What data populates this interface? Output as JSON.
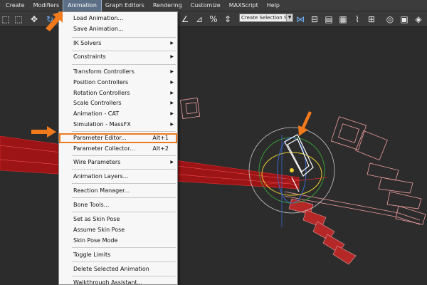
{
  "menubar": {
    "items": [
      "Create",
      "Modifiers",
      "Animation",
      "Graph Editors",
      "Rendering",
      "Customize",
      "MAXScript",
      "Help"
    ],
    "active_index": 2
  },
  "toolbar": {
    "selection_set": "Create Selection Se"
  },
  "animation_menu": {
    "items": [
      {
        "label": "Load Animation...",
        "shortcut": "",
        "submenu": false
      },
      {
        "label": "Save Animation...",
        "shortcut": "",
        "submenu": false
      },
      {
        "label": "IK Solvers",
        "shortcut": "",
        "submenu": true
      },
      {
        "label": "Constraints",
        "shortcut": "",
        "submenu": true
      },
      {
        "label": "Transform Controllers",
        "shortcut": "",
        "submenu": true
      },
      {
        "label": "Position Controllers",
        "shortcut": "",
        "submenu": true
      },
      {
        "label": "Rotation Controllers",
        "shortcut": "",
        "submenu": true
      },
      {
        "label": "Scale Controllers",
        "shortcut": "",
        "submenu": true
      },
      {
        "label": "Animation - CAT",
        "shortcut": "",
        "submenu": true
      },
      {
        "label": "Simulation - MassFX",
        "shortcut": "",
        "submenu": true
      },
      {
        "label": "Parameter Editor...",
        "shortcut": "Alt+1",
        "submenu": false,
        "highlighted": true
      },
      {
        "label": "Parameter Collector...",
        "shortcut": "Alt+2",
        "submenu": false
      },
      {
        "label": "Wire Parameters",
        "shortcut": "",
        "submenu": true
      },
      {
        "label": "Animation Layers...",
        "shortcut": "",
        "submenu": false
      },
      {
        "label": "Reaction Manager...",
        "shortcut": "",
        "submenu": false
      },
      {
        "label": "Bone Tools...",
        "shortcut": "",
        "submenu": false
      },
      {
        "label": "Set as Skin Pose",
        "shortcut": "",
        "submenu": false
      },
      {
        "label": "Assume Skin Pose",
        "shortcut": "",
        "submenu": false
      },
      {
        "label": "Skin Pose Mode",
        "shortcut": "",
        "submenu": false
      },
      {
        "label": "Toggle Limits",
        "shortcut": "",
        "submenu": false
      },
      {
        "label": "Delete Selected Animation",
        "shortcut": "",
        "submenu": false
      },
      {
        "label": "Walkthrough Assistant...",
        "shortcut": "",
        "submenu": false
      }
    ]
  },
  "colors": {
    "highlight_outline": "#f07a1c",
    "arrow": "#f07a1c",
    "mesh_red": "#c8181c",
    "mesh_pink": "#f4a0a0"
  }
}
